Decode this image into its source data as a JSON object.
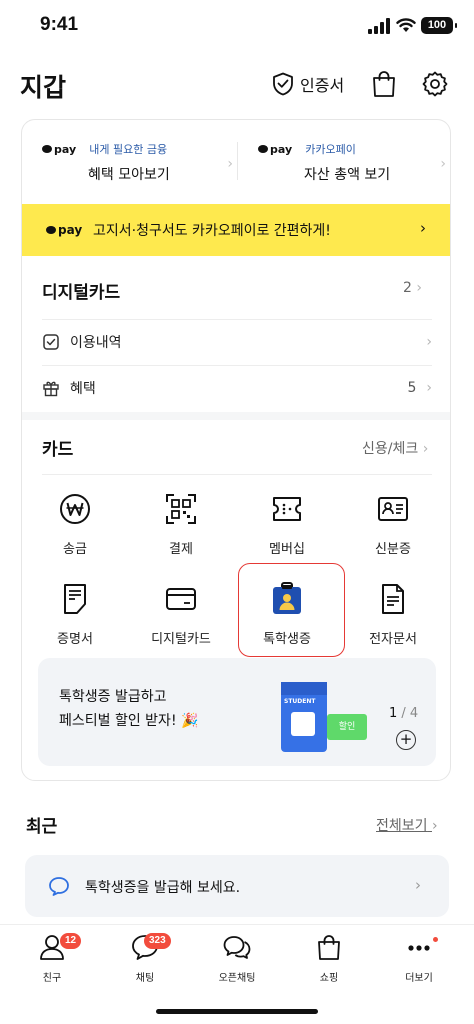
{
  "status_bar": {
    "time": "9:41",
    "battery": "100"
  },
  "header": {
    "title": "지갑",
    "cert_label": "인증서",
    "icons": [
      "shield-check-icon",
      "shopping-bag-icon",
      "gear-icon"
    ]
  },
  "pay_shortcuts": [
    {
      "logo": "pay",
      "subtitle": "내게 필요한 금융",
      "title": "혜택 모아보기"
    },
    {
      "logo": "pay",
      "subtitle": "카카오페이",
      "title": "자산 총액 보기"
    }
  ],
  "banner": {
    "logo": "pay",
    "text": "고지서·청구서도 카카오페이로 간편하게!",
    "color": "#fee94e"
  },
  "digital_card": {
    "title": "디지털카드",
    "count": "2",
    "rows": [
      {
        "label": "이용내역",
        "value": ""
      },
      {
        "label": "혜택",
        "value": "5"
      }
    ]
  },
  "cards": {
    "title": "카드",
    "link": "신용/체크",
    "items": [
      {
        "label": "송금",
        "icon": "won-coin-icon"
      },
      {
        "label": "결제",
        "icon": "qr-scan-icon"
      },
      {
        "label": "멤버십",
        "icon": "membership-ticket-icon"
      },
      {
        "label": "신분증",
        "icon": "id-card-icon"
      },
      {
        "label": "증명서",
        "icon": "certificate-icon"
      },
      {
        "label": "디지털카드",
        "icon": "credit-card-icon"
      },
      {
        "label": "톡학생증",
        "icon": "student-id-icon"
      },
      {
        "label": "전자문서",
        "icon": "document-icon"
      }
    ]
  },
  "promo": {
    "line1": "톡학생증 발급하고",
    "line2": "페스티벌 할인 받자! 🎉",
    "card_text": "STUDENT",
    "ticket_text": "할인",
    "page_current": "1",
    "page_total": "/ 4",
    "plus": "+"
  },
  "recent": {
    "title": "최근",
    "see_all": "전체보기",
    "item": "톡학생증을 발급해 보세요."
  },
  "tabbar": [
    {
      "label": "친구",
      "badge": "12",
      "icon": "person-icon"
    },
    {
      "label": "채팅",
      "badge": "323",
      "icon": "chat-bubble-icon"
    },
    {
      "label": "오픈채팅",
      "badge": "",
      "icon": "open-chat-icon"
    },
    {
      "label": "쇼핑",
      "badge": "",
      "icon": "shopping-bag-icon"
    },
    {
      "label": "더보기",
      "badge": "",
      "icon": "more-dots-icon"
    }
  ],
  "colors": {
    "accent_yellow": "#fee94e",
    "badge_red": "#f24c3d",
    "highlight_red": "#e53935",
    "link_blue": "#2b5ba8"
  }
}
